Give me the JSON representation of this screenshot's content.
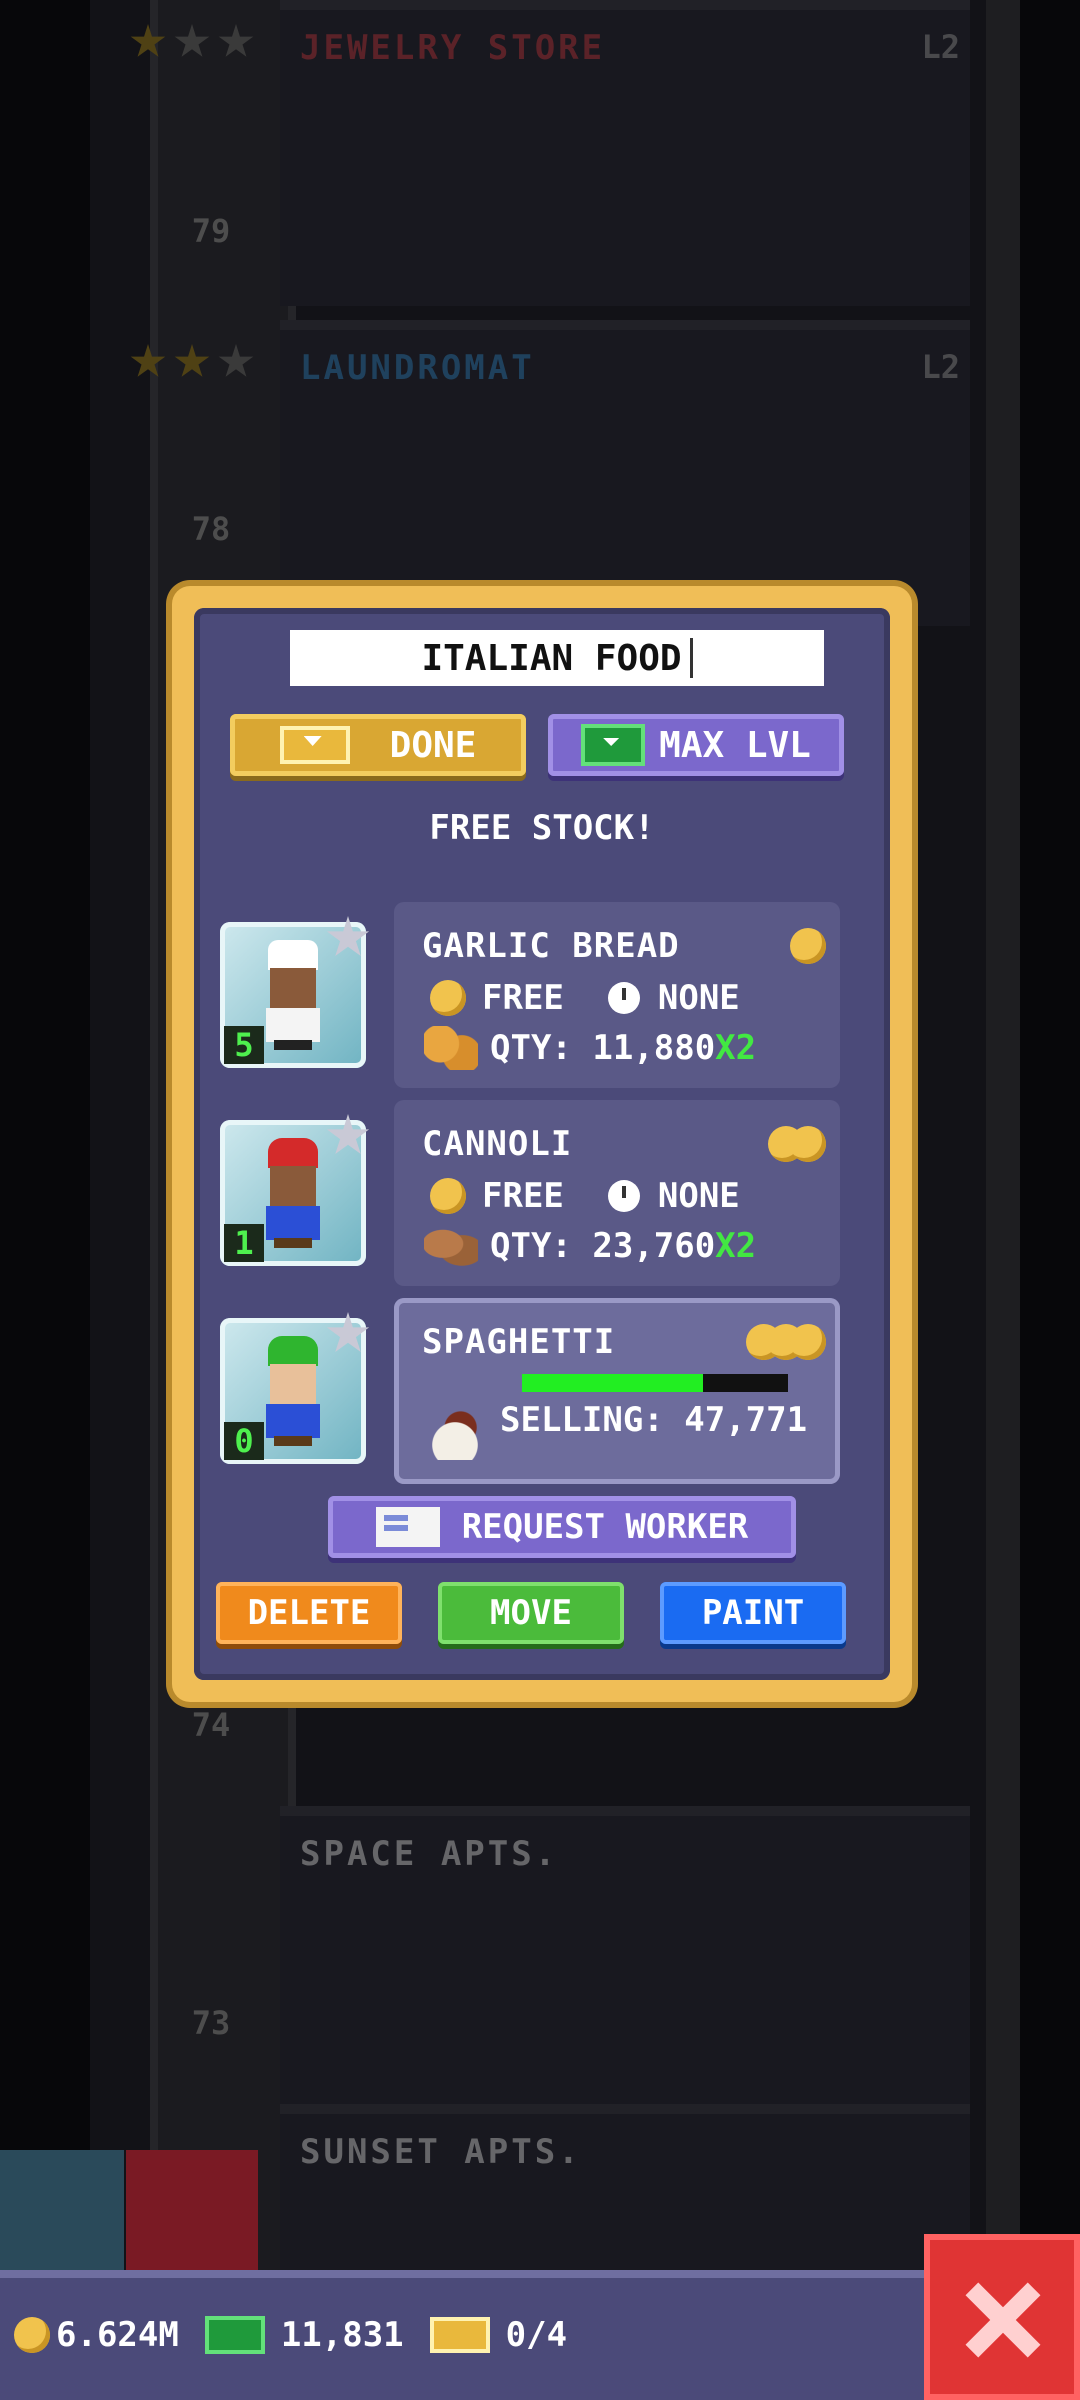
{
  "tower": {
    "floors": [
      {
        "name": "JEWELRY STORE",
        "level": "L2",
        "number": "79",
        "color": "#e0434a"
      },
      {
        "name": "LAUNDROMAT",
        "level": "L2",
        "number": "78",
        "color": "#3a9ae0"
      },
      {
        "name": "SPACE APTS.",
        "level": "",
        "number": "73",
        "color": "#9a9aaa"
      },
      {
        "name": "SUNSET APTS.",
        "level": "",
        "number": "",
        "color": "#9a9aaa"
      }
    ],
    "extra_floor_number": "74"
  },
  "dialog": {
    "name_value": "ITALIAN FOOD",
    "done_label": "DONE",
    "max_lvl_label": "MAX LVL",
    "banner": "FREE STOCK!",
    "items": [
      {
        "name": "GARLIC BREAD",
        "price_coins": 1,
        "cost": "FREE",
        "time": "NONE",
        "qty_label": "QTY: 11,880",
        "multiplier": "X2",
        "worker_level": "5",
        "worker": "chef"
      },
      {
        "name": "CANNOLI",
        "price_coins": 2,
        "cost": "FREE",
        "time": "NONE",
        "qty_label": "QTY: 23,760",
        "multiplier": "X2",
        "worker_level": "1",
        "worker": "red-plumber"
      },
      {
        "name": "SPAGHETTI",
        "price_coins": 3,
        "selling_label": "SELLING: 47,771",
        "progress": 0.68,
        "worker_level": "0",
        "worker": "green-plumber"
      }
    ],
    "request_worker_label": "REQUEST WORKER",
    "delete_label": "DELETE",
    "move_label": "MOVE",
    "paint_label": "PAINT"
  },
  "status_bar": {
    "coins": "6.624M",
    "bux": "11,831",
    "tickets": "0/4"
  },
  "colors": {
    "dialog_frame": "#f0be57",
    "dialog_body": "#4b4a79",
    "done": "#d9a733",
    "max_lvl": "#7b68cc",
    "delete": "#f08a1c",
    "move": "#4bbb3b",
    "paint": "#1a6bf2",
    "close": "#e03434",
    "multiplier": "#42e842"
  }
}
